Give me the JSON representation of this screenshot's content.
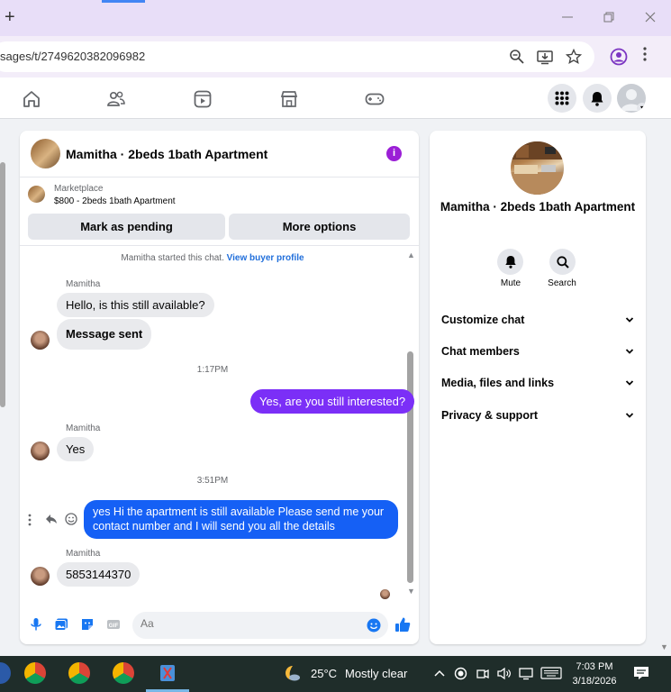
{
  "browser": {
    "url": "sages/t/2749620382096982",
    "newtab_glyph": "+"
  },
  "fbnav": {
    "icons": [
      "home-icon",
      "friends-icon",
      "watch-icon",
      "marketplace-icon",
      "gaming-icon"
    ],
    "right": [
      "menu-grid-icon",
      "notifications-icon",
      "account-avatar"
    ]
  },
  "chat": {
    "title": "Mamitha · 2beds 1bath Apartment",
    "marketplace_label": "Marketplace",
    "listing": "$800 - 2beds 1bath Apartment",
    "mark_pending": "Mark as pending",
    "more_options": "More options",
    "started_text": "Mamitha started this chat.",
    "view_buyer": "View buyer profile",
    "messages": {
      "sender1": "Mamitha",
      "m1": "Hello, is this still available?",
      "m2": "Message sent",
      "time1": "1:17PM",
      "out1": "Yes, are you still interested?",
      "sender2": "Mamitha",
      "m3": "Yes",
      "time2": "3:51PM",
      "out2": "yes Hi the apartment is still available Please send me your contact number and I will send you all the details",
      "sender3": "Mamitha",
      "m4": "5853144370"
    },
    "composer_placeholder": "Aa"
  },
  "info": {
    "title": "Mamitha · 2beds 1bath Apartment",
    "mute": "Mute",
    "search": "Search",
    "sections": [
      "Customize chat",
      "Chat members",
      "Media, files and links",
      "Privacy & support"
    ]
  },
  "taskbar": {
    "temperature": "25°C",
    "weather": "Mostly clear",
    "time": "7:03 PM",
    "date": "3/18/2026"
  },
  "colors": {
    "outgoing_purple": "#7b2ff7",
    "outgoing_blue": "#1560f5",
    "info_purple": "#9b1fd6",
    "link_blue": "#216fdb",
    "like_blue": "#1877f2"
  }
}
